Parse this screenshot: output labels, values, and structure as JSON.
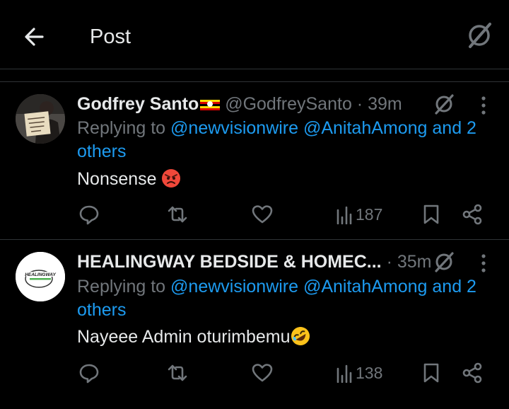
{
  "header": {
    "title": "Post"
  },
  "tweets": [
    {
      "name": "Godfrey Santo",
      "handle": "@GodfreySanto",
      "time": "· 39m",
      "replying_prefix": "Replying to ",
      "replying_to": "@newvisionwire @AnitahAmong and 2 others",
      "text": "Nonsense",
      "views": "187",
      "emoji": "angry-face-emoji",
      "name_badge": "uganda-flag"
    },
    {
      "name": "HEALINGWAY BEDSIDE & HOMEC...",
      "handle": "",
      "time": "· 35m",
      "replying_prefix": "Replying to ",
      "replying_to": "@newvisionwire @AnitahAmong and 2 others",
      "text": "Nayeee Admin oturimbemu",
      "views": "138",
      "emoji": "rolling-on-floor-laughing-emoji",
      "avatar_logo_text": "HEALINGWAY"
    }
  ],
  "colors": {
    "background": "#000000",
    "text": "#e7e9ea",
    "muted": "#71767b",
    "link": "#1d9bf0",
    "divider": "#2f3336"
  }
}
